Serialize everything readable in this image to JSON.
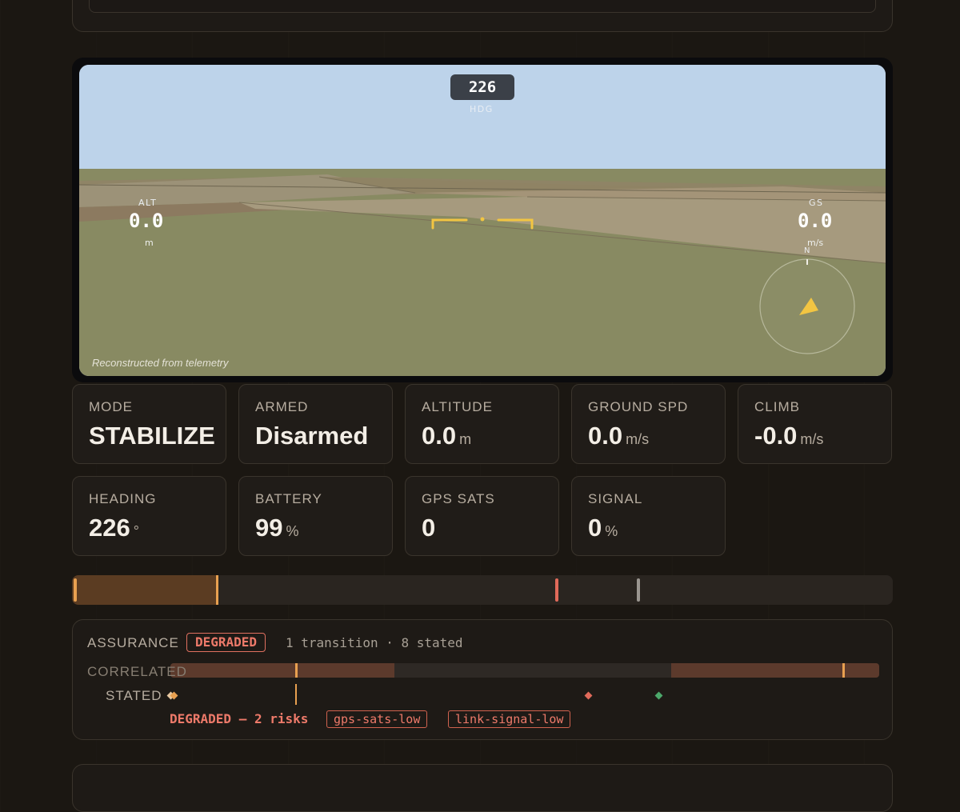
{
  "viewport": {
    "heading_value": "226",
    "heading_label": "HDG",
    "alt_label": "ALT",
    "alt_value": "0.0",
    "alt_unit": "m",
    "gs_label": "GS",
    "gs_value": "0.0",
    "gs_unit": "m/s",
    "compass_north": "N",
    "note": "Reconstructed from telemetry",
    "colors": {
      "sky": "#bdd3ea",
      "ground": "#888a62",
      "reticle": "#f2c542"
    }
  },
  "stats": [
    {
      "label": "MODE",
      "value": "STABILIZE",
      "unit": ""
    },
    {
      "label": "ARMED",
      "value": "Disarmed",
      "unit": ""
    },
    {
      "label": "ALTITUDE",
      "value": "0.0",
      "unit": "m"
    },
    {
      "label": "GROUND SPD",
      "value": "0.0",
      "unit": "m/s"
    },
    {
      "label": "CLIMB",
      "value": "-0.0",
      "unit": "m/s"
    },
    {
      "label": "HEADING",
      "value": "226",
      "unit": "°"
    },
    {
      "label": "BATTERY",
      "value": "99",
      "unit": "%"
    },
    {
      "label": "GPS SATS",
      "value": "0",
      "unit": ""
    },
    {
      "label": "SIGNAL",
      "value": "0",
      "unit": "%"
    }
  ],
  "timeline": {
    "progress_fraction": 0.177
  },
  "assurance": {
    "title": "ASSURANCE",
    "status": "DEGRADED",
    "summary": "1 transition · 8 stated",
    "correlated_label": "CORRELATED",
    "stated_label": "STATED",
    "risk_text": "DEGRADED — 2 risks",
    "risks": [
      "gps-sats-low",
      "link-signal-low"
    ],
    "colors": {
      "degraded": "#ee7a6a",
      "marker": "#e8a050",
      "ok": "#4ca86a"
    }
  }
}
